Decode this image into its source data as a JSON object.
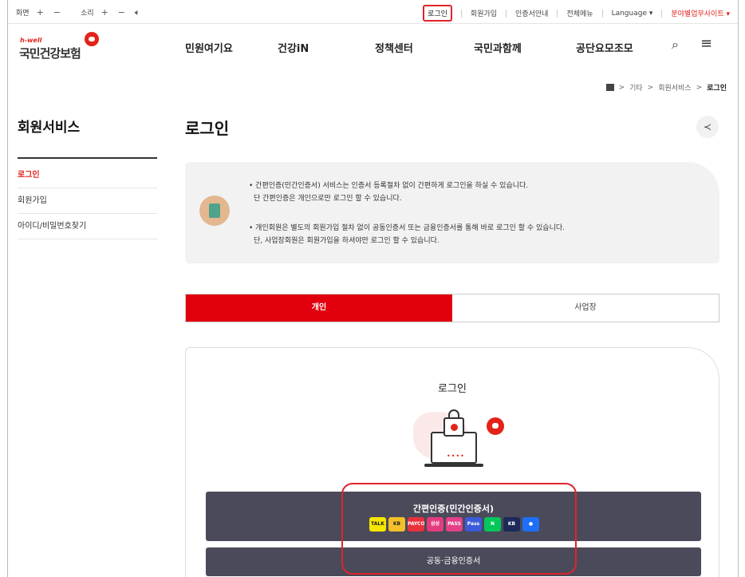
{
  "util": {
    "screen_label": "화면",
    "sound_label": "소리",
    "plus": "+",
    "minus": "−",
    "sound_icon": "🔈︎",
    "links": [
      "로그인",
      "회원가입",
      "인증서안내",
      "전체메뉴"
    ],
    "language": "Language ▾",
    "biz_site": "분야별업무사이트 ▾"
  },
  "logo": {
    "hwell": "h-well",
    "name": "국민건강보험"
  },
  "gnb": [
    "민원여기요",
    "건강iN",
    "정책센터",
    "국민과함께",
    "공단요모조모"
  ],
  "icons": {
    "search": "⌕",
    "menu": "≡",
    "share": "≺"
  },
  "breadcrumb": {
    "items": [
      "기타",
      "회원서비스"
    ],
    "current": "로그인",
    "sep": ">"
  },
  "lnb": {
    "title": "회원서비스",
    "items": [
      "로그인",
      "회원가입",
      "아이디/비밀번호찾기"
    ]
  },
  "page_title": "로그인",
  "notice": {
    "lines": [
      "• 간편인증(민간인증서) 서비스는 인증서 등록절차 없이 간편하게 로그인을 하실 수 있습니다.",
      "단 간편인증은 개인으로만 로그인 할 수 있습니다.",
      "• 개인회원은 별도의 회원가입 절차 없이 공동인증서 또는 금융인증서를 통해 바로 로그인 할 수 있습니다.",
      "단, 사업장회원은 회원가입을 하셔야만 로그인 할 수 있습니다."
    ]
  },
  "tabs": [
    "개인",
    "사업장"
  ],
  "card": {
    "title": "로그인",
    "lock_dots": "••••",
    "simple_auth_label": "간편인증(민간인증서)",
    "providers": [
      {
        "label": "TALK",
        "color": "#f7e600"
      },
      {
        "label": "KB",
        "color": "#f2c029"
      },
      {
        "label": "PAYCO",
        "color": "#e8313b"
      },
      {
        "label": "삼성",
        "color": "#e33c7e"
      },
      {
        "label": "PASS",
        "color": "#e3408a"
      },
      {
        "label": "Pass",
        "color": "#3b5bd9"
      },
      {
        "label": "N",
        "color": "#03c75a"
      },
      {
        "label": "KB",
        "color": "#1c2a5a"
      },
      {
        "label": "●",
        "color": "#1e6ff5"
      }
    ],
    "cert_label": "공동·금융인증서"
  }
}
